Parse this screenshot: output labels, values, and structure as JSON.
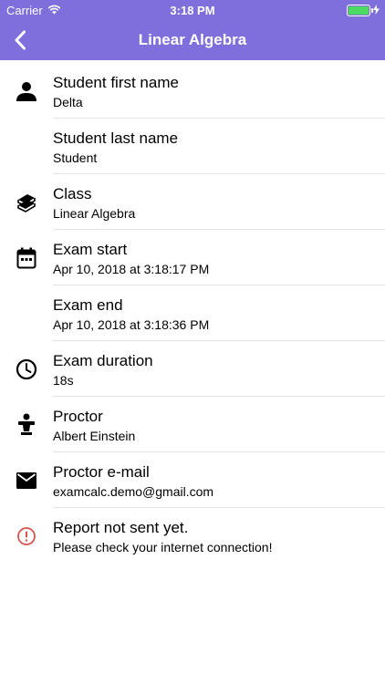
{
  "status_bar": {
    "carrier": "Carrier",
    "time": "3:18 PM",
    "battery_level": 1.0
  },
  "nav": {
    "title": "Linear Algebra",
    "back_icon": "chevron-left-icon"
  },
  "colors": {
    "header_bg": "#7f6fdc",
    "warning": "#d9534f"
  },
  "rows": [
    {
      "icon": "person-icon",
      "label": "Student first name",
      "value": "Delta"
    },
    {
      "icon": "",
      "label": "Student last name",
      "value": "Student"
    },
    {
      "icon": "books-icon",
      "label": "Class",
      "value": "Linear Algebra"
    },
    {
      "icon": "calendar-icon",
      "label": "Exam start",
      "value": "Apr 10, 2018 at 3:18:17 PM"
    },
    {
      "icon": "",
      "label": "Exam end",
      "value": "Apr 10, 2018 at 3:18:36 PM"
    },
    {
      "icon": "clock-icon",
      "label": "Exam duration",
      "value": "18s"
    },
    {
      "icon": "proctor-icon",
      "label": "Proctor",
      "value": "Albert Einstein"
    },
    {
      "icon": "mail-icon",
      "label": "Proctor e-mail",
      "value": "examcalc.demo@gmail.com"
    },
    {
      "icon": "alert-icon",
      "label": "Report not sent yet.",
      "value": "Please check your internet connection!"
    }
  ]
}
